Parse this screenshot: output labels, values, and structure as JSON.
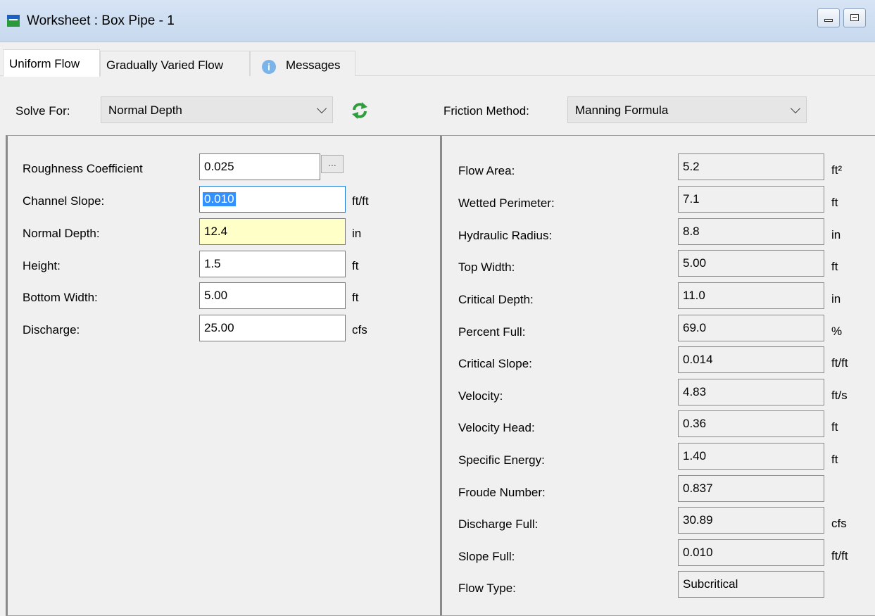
{
  "window": {
    "title": "Worksheet : Box Pipe - 1",
    "icon": "worksheet-icon"
  },
  "tabs": [
    "Uniform Flow",
    "Gradually Varied Flow",
    "Messages"
  ],
  "solve_bar": {
    "solve_for_label": "Solve For:",
    "solve_for_value": "Normal Depth",
    "refresh_icon": "refresh-icon",
    "friction_label": "Friction Method:",
    "friction_value": "Manning Formula"
  },
  "inputs": [
    {
      "label": "Roughness Coefficient",
      "value": "0.025",
      "unit": ""
    },
    {
      "label": "Channel Slope:",
      "value": "0.010",
      "unit": "ft/ft"
    },
    {
      "label": "Normal Depth:",
      "value": "12.4",
      "unit": "in"
    },
    {
      "label": "Height:",
      "value": "1.5",
      "unit": "ft"
    },
    {
      "label": "Bottom Width:",
      "value": "5.00",
      "unit": "ft"
    },
    {
      "label": "Discharge:",
      "value": "25.00",
      "unit": "cfs"
    }
  ],
  "ellipsis_label": "...",
  "results": [
    {
      "label": "Flow Area:",
      "value": "5.2",
      "unit": "ft²"
    },
    {
      "label": "Wetted Perimeter:",
      "value": "7.1",
      "unit": "ft"
    },
    {
      "label": "Hydraulic Radius:",
      "value": "8.8",
      "unit": "in"
    },
    {
      "label": "Top Width:",
      "value": "5.00",
      "unit": "ft"
    },
    {
      "label": "Critical Depth:",
      "value": "11.0",
      "unit": "in"
    },
    {
      "label": "Percent Full:",
      "value": "69.0",
      "unit": "%"
    },
    {
      "label": "Critical Slope:",
      "value": "0.014",
      "unit": "ft/ft"
    },
    {
      "label": "Velocity:",
      "value": "4.83",
      "unit": "ft/s"
    },
    {
      "label": "Velocity Head:",
      "value": "0.36",
      "unit": "ft"
    },
    {
      "label": "Specific Energy:",
      "value": "1.40",
      "unit": "ft"
    },
    {
      "label": "Froude Number:",
      "value": "0.837",
      "unit": ""
    },
    {
      "label": "Discharge Full:",
      "value": "30.89",
      "unit": "cfs"
    },
    {
      "label": "Slope Full:",
      "value": "0.010",
      "unit": "ft/ft"
    },
    {
      "label": "Flow Type:",
      "value": "Subcritical",
      "unit": ""
    }
  ]
}
